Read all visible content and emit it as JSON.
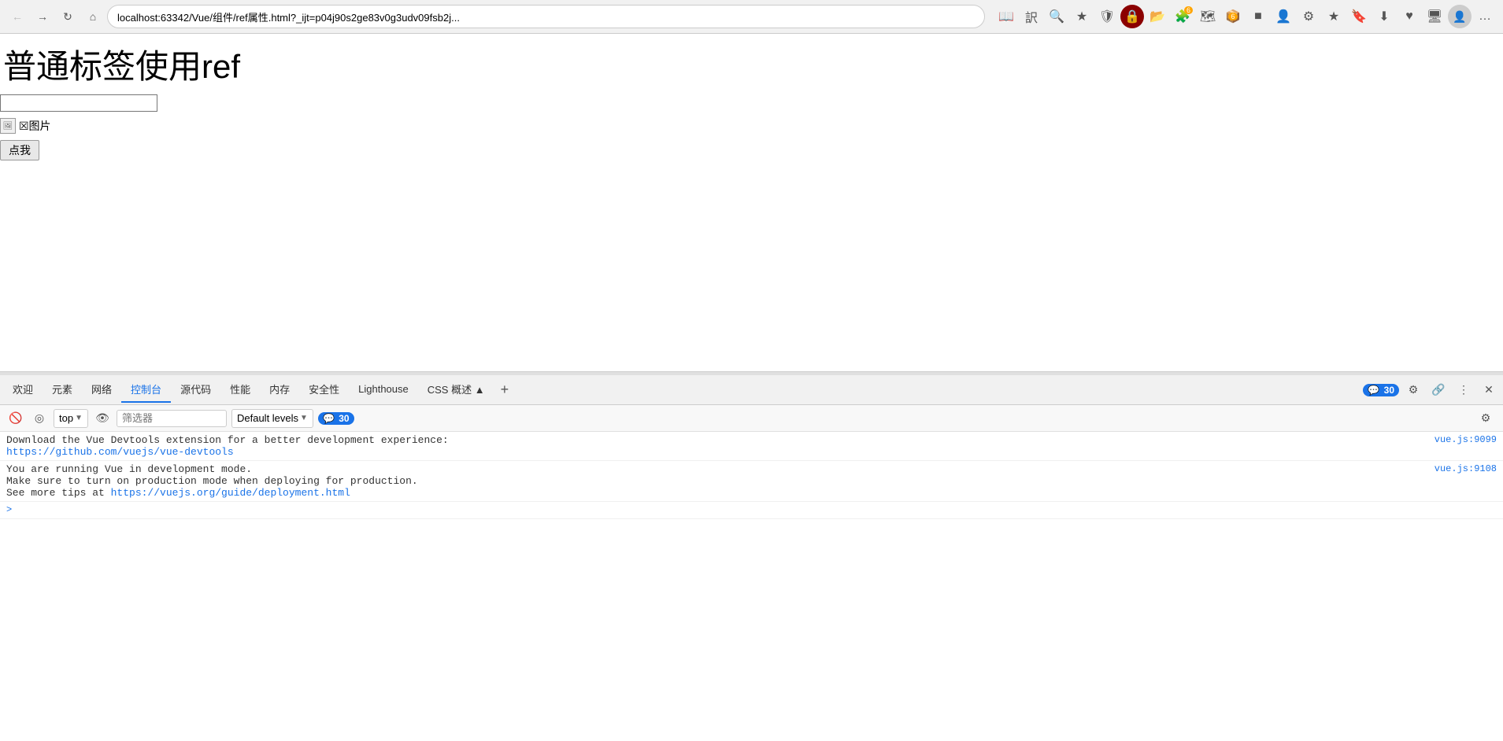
{
  "browser": {
    "url": "localhost:63342/Vue/组件/ref属性.html?_ijt=p04j90s2ge83v0g3udv09fsb2j...",
    "back_btn": "←",
    "forward_btn": "→",
    "reload_btn": "↻",
    "home_btn": "⌂"
  },
  "page": {
    "title": "普通标签使用ref",
    "input_placeholder": "",
    "broken_img_label": "☒图片",
    "click_btn_label": "点我"
  },
  "devtools": {
    "tabs": [
      {
        "label": "欢迎",
        "active": false
      },
      {
        "label": "元素",
        "active": false
      },
      {
        "label": "网络",
        "active": false
      },
      {
        "label": "控制台",
        "active": true
      },
      {
        "label": "源代码",
        "active": false
      },
      {
        "label": "性能",
        "active": false
      },
      {
        "label": "内存",
        "active": false
      },
      {
        "label": "安全性",
        "active": false
      },
      {
        "label": "Lighthouse",
        "active": false
      },
      {
        "label": "CSS 概述 ▲",
        "active": false
      }
    ],
    "badge_count": "30",
    "toolbar": {
      "context_label": "top",
      "filter_placeholder": "筛选器",
      "level_label": "Default levels",
      "msg_count": "30"
    },
    "console_messages": [
      {
        "text": "Download the Vue Devtools extension for a better development experience:",
        "link": "https://github.com/vuejs/vue-devtools",
        "source": "vue.js:9099"
      },
      {
        "text": "You are running Vue in development mode.\nMake sure to turn on production mode when deploying for production.\nSee more tips at ",
        "link": "https://vuejs.org/guide/deployment.html",
        "source": "vue.js:9108"
      }
    ],
    "expand_arrow": ">"
  }
}
